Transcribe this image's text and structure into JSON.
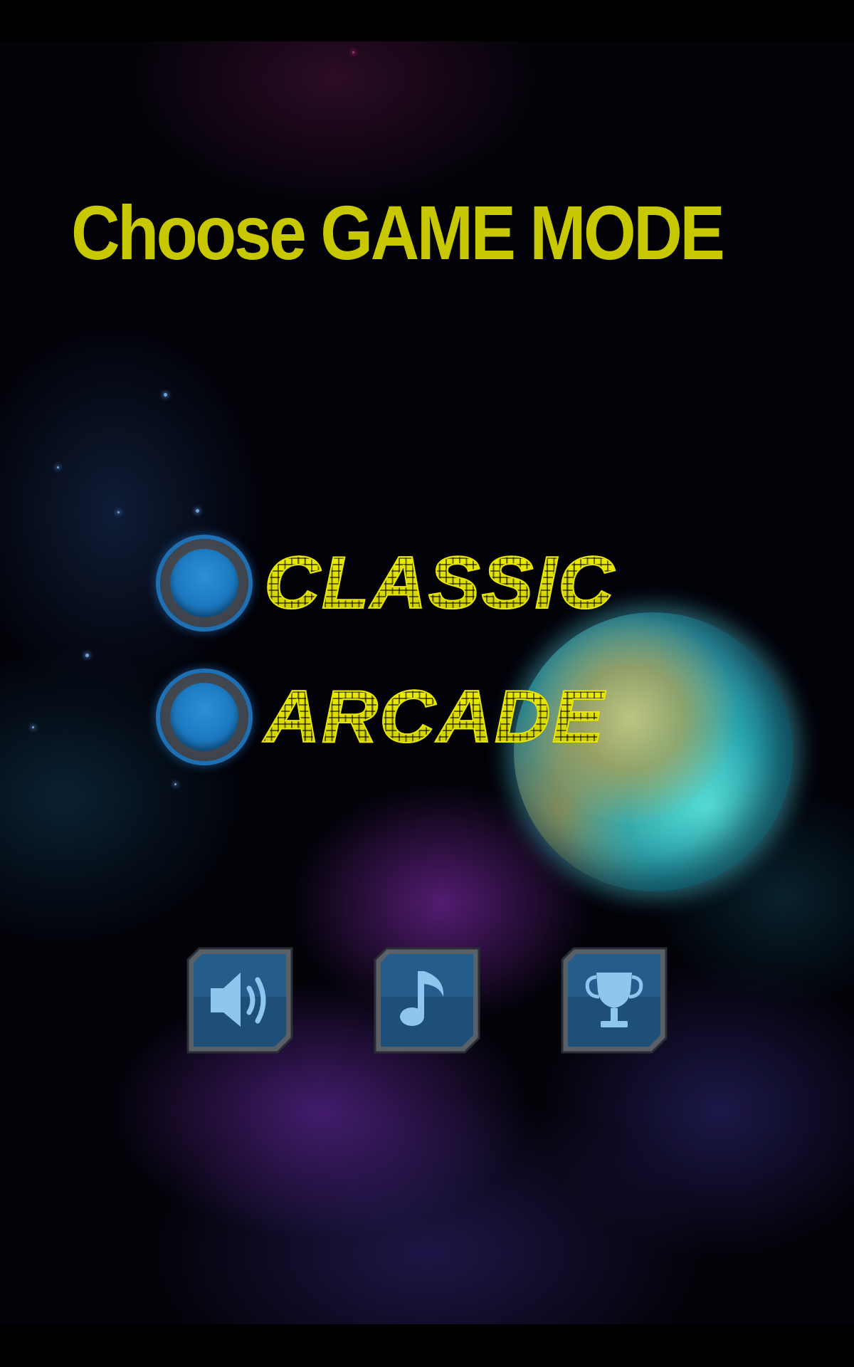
{
  "title": "Choose GAME MODE",
  "modes": [
    {
      "label": "CLASSIC",
      "selected": false
    },
    {
      "label": "ARCADE",
      "selected": false
    }
  ],
  "buttons": [
    {
      "icon": "speaker-icon"
    },
    {
      "icon": "music-note-icon"
    },
    {
      "icon": "trophy-icon"
    }
  ],
  "colors": {
    "title": "#c8c800",
    "mode_text": "#e6e600",
    "radio_ring": "#1f6fb3",
    "button_frame": "#5a6068",
    "button_fill": "#1e4f78",
    "icon_glyph": "#8fc6ee"
  }
}
